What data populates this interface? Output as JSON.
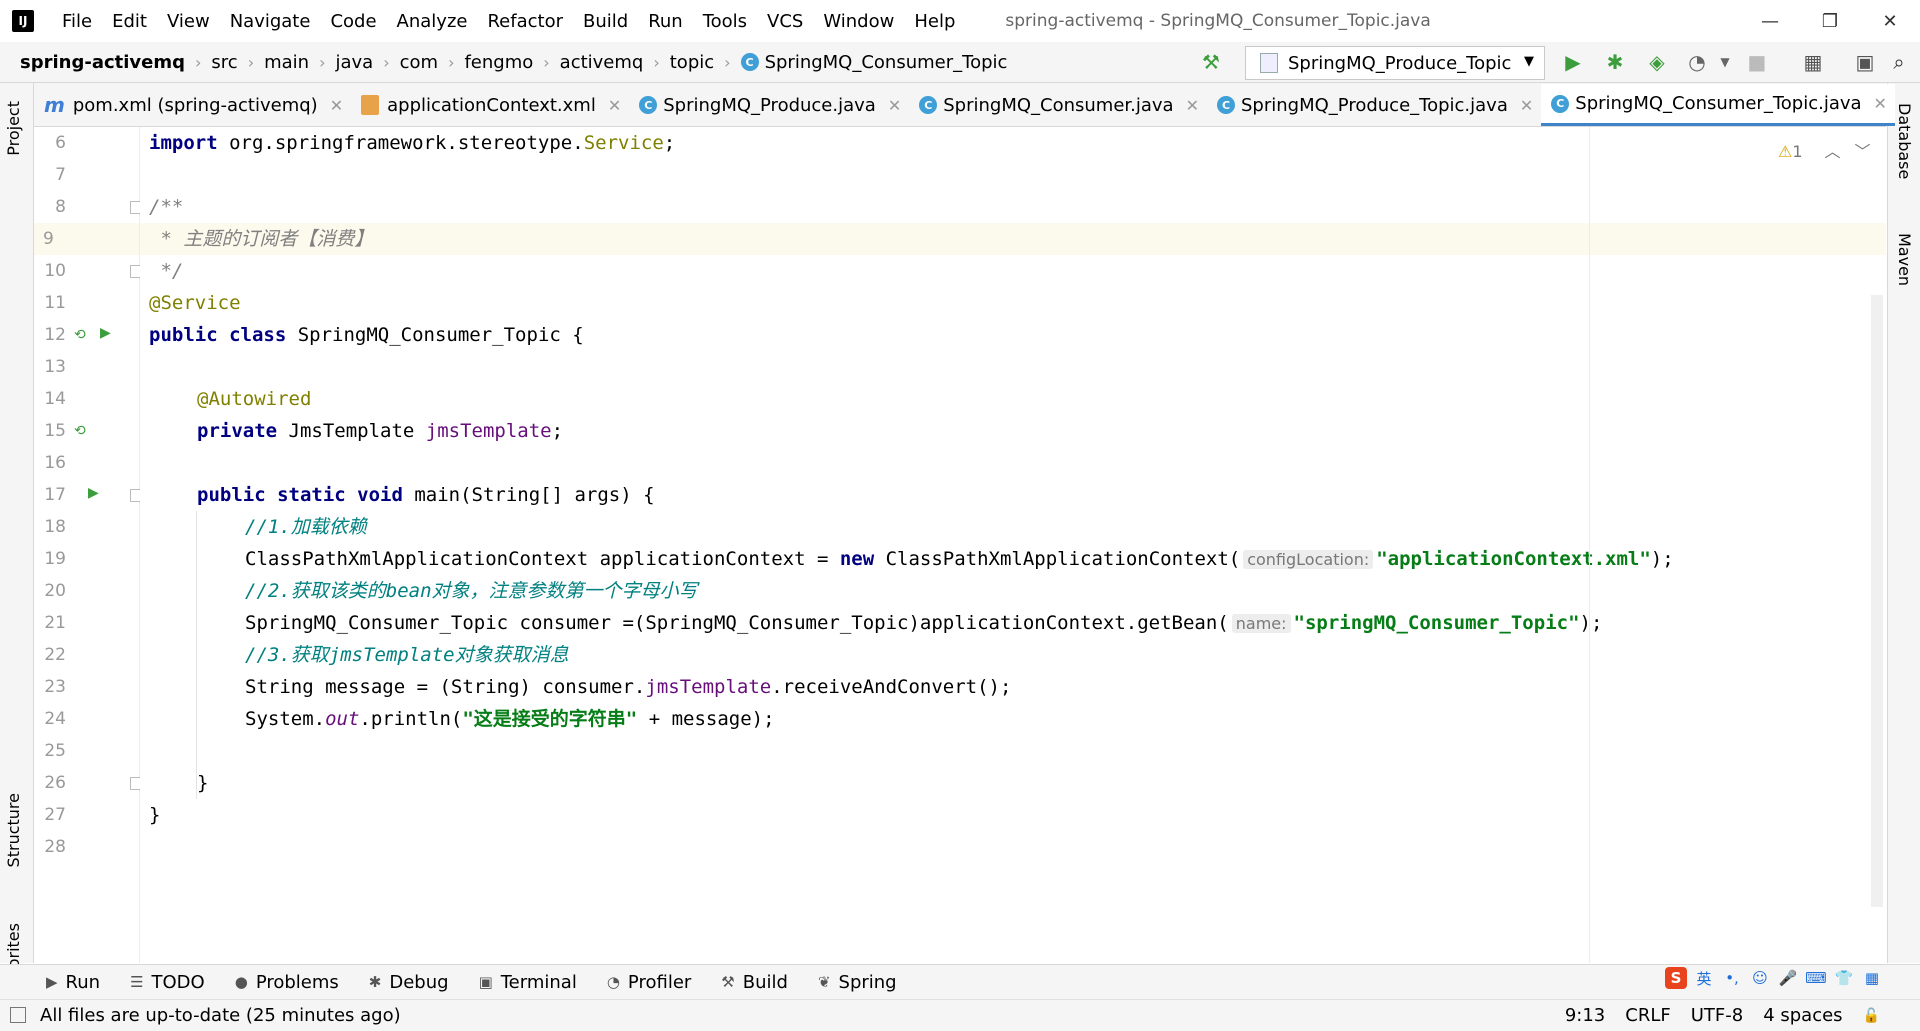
{
  "window": {
    "title": "spring-activemq - SpringMQ_Consumer_Topic.java",
    "logo_text": "IJ",
    "controls": [
      "—",
      "❐",
      "✕"
    ]
  },
  "menu": [
    "File",
    "Edit",
    "View",
    "Navigate",
    "Code",
    "Analyze",
    "Refactor",
    "Build",
    "Run",
    "Tools",
    "VCS",
    "Window",
    "Help"
  ],
  "breadcrumb": [
    "spring-activemq",
    "src",
    "main",
    "java",
    "com",
    "fengmo",
    "activemq",
    "topic",
    "SpringMQ_Consumer_Topic"
  ],
  "run_config": {
    "selected": "SpringMQ_Produce_Topic"
  },
  "tabs": [
    {
      "label": "pom.xml (spring-activemq)",
      "icon": "maven-icon"
    },
    {
      "label": "applicationContext.xml",
      "icon": "xml-icon"
    },
    {
      "label": "SpringMQ_Produce.java",
      "icon": "class-icon"
    },
    {
      "label": "SpringMQ_Consumer.java",
      "icon": "class-icon"
    },
    {
      "label": "SpringMQ_Produce_Topic.java",
      "icon": "class-icon"
    },
    {
      "label": "SpringMQ_Consumer_Topic.java",
      "icon": "class-icon",
      "active": true
    }
  ],
  "side_tabs": {
    "left": [
      "Project",
      "Structure",
      "Favorites"
    ],
    "right": [
      "Database",
      "Maven"
    ]
  },
  "editor": {
    "warning_count": "1",
    "line_numbers": [
      "6",
      "7",
      "8",
      "9",
      "10",
      "11",
      "12",
      "13",
      "14",
      "15",
      "16",
      "17",
      "18",
      "19",
      "20",
      "21",
      "22",
      "23",
      "24",
      "25",
      "26",
      "27",
      "28"
    ],
    "code": {
      "l6_kw": "import",
      "l6_pkg": " org.springframework.stereotype.",
      "l6_cls": "Service",
      "l6_end": ";",
      "l8": "/**",
      "l9": " * 主题的订阅者【消费】",
      "l10": " */",
      "l11": "@Service",
      "l12_kw": "public class",
      "l12_rest": " SpringMQ_Consumer_Topic {",
      "l14": "@Autowired",
      "l15_kw": "private",
      "l15_type": " JmsTemplate ",
      "l15_field": "jmsTemplate",
      "l15_end": ";",
      "l17_kw": "public static void",
      "l17_rest": " main(String[] args) {",
      "l18": "//1.加载依赖",
      "l19_a": "ClassPathXmlApplicationContext applicationContext = ",
      "l19_kw": "new",
      "l19_b": " ClassPathXmlApplicationContext(",
      "l19_hint": "configLocation:",
      "l19_str": "\"applicationContext.xml\"",
      "l19_end": ");",
      "l20": "//2.获取该类的bean对象，注意参数第一个字母小写",
      "l21_a": "SpringMQ_Consumer_Topic consumer =(SpringMQ_Consumer_Topic)applicationContext.getBean(",
      "l21_hint": "name:",
      "l21_str": "\"springMQ_Consumer_Topic\"",
      "l21_end": ");",
      "l22": "//3.获取jmsTemplate对象获取消息",
      "l23_a": "String message = (String) consumer.",
      "l23_field": "jmsTemplate",
      "l23_b": ".receiveAndConvert();",
      "l24_a": "System.",
      "l24_field": "out",
      "l24_b": ".println(",
      "l24_str": "\"这是接受的字符串\"",
      "l24_c": " + message);",
      "l26": "}",
      "l27": "}"
    }
  },
  "tool_windows": [
    {
      "label": "Run",
      "icon": "run-icon"
    },
    {
      "label": "TODO",
      "icon": "todo-icon"
    },
    {
      "label": "Problems",
      "icon": "problems-icon"
    },
    {
      "label": "Debug",
      "icon": "debug-icon"
    },
    {
      "label": "Terminal",
      "icon": "terminal-icon"
    },
    {
      "label": "Profiler",
      "icon": "profiler-icon"
    },
    {
      "label": "Build",
      "icon": "build-icon"
    },
    {
      "label": "Spring",
      "icon": "spring-icon"
    }
  ],
  "status": {
    "message": "All files are up-to-date (25 minutes ago)",
    "position": "9:13",
    "line_sep": "CRLF",
    "encoding": "UTF-8",
    "indent": "4 spaces",
    "ime_lang": "英"
  },
  "colors": {
    "accent": "#4083c9",
    "run_green": "#3c9d3c",
    "line_highlight": "#fcfaed"
  }
}
